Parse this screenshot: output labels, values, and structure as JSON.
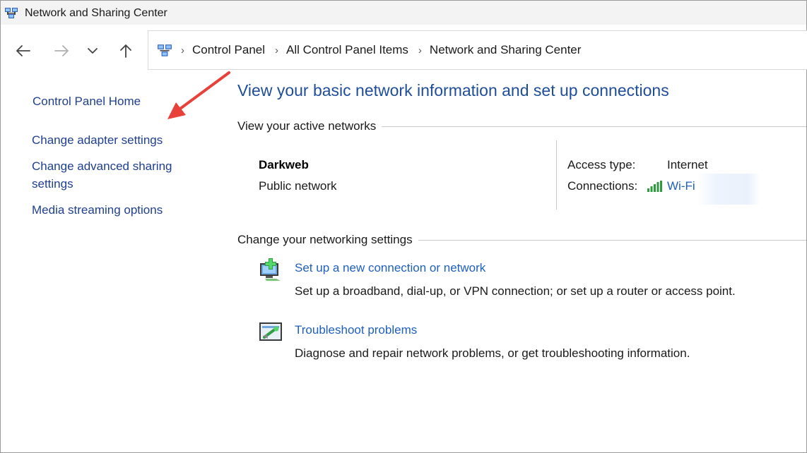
{
  "window": {
    "title": "Network and Sharing Center",
    "icon": "network-center-icon"
  },
  "navigation": {
    "back": "back-arrow-icon",
    "forward": "forward-arrow-icon",
    "recent": "chevron-down-icon",
    "up": "up-arrow-icon",
    "breadcrumb": [
      "Control Panel",
      "All Control Panel Items",
      "Network and Sharing Center"
    ]
  },
  "sidebar": {
    "items": [
      {
        "label": "Control Panel Home"
      },
      {
        "label": "Change adapter settings"
      },
      {
        "label": "Change advanced sharing",
        "label2": "settings"
      },
      {
        "label": "Media streaming options"
      }
    ]
  },
  "main": {
    "heading": "View your basic network information and set up connections",
    "active_networks": {
      "title": "View your active networks",
      "network_name": "Darkweb",
      "network_type": "Public network",
      "access_type_label": "Access type:",
      "access_type_value": "Internet",
      "connections_label": "Connections:",
      "connections_value": "Wi-Fi"
    },
    "networking_settings": {
      "title": "Change your networking settings",
      "tasks": [
        {
          "link": "Set up a new connection or network",
          "description": "Set up a broadband, dial-up, or VPN connection; or set up a router or access point.",
          "icon": "new-connection-icon"
        },
        {
          "link": "Troubleshoot problems",
          "description": "Diagnose and repair network problems, or get troubleshooting information.",
          "icon": "troubleshoot-icon"
        }
      ]
    }
  },
  "colors": {
    "link": "#1e5fbf",
    "sidebar_link": "#1f3f8f",
    "heading": "#1e4e9a",
    "annotation_arrow": "#e8413a",
    "signal": "#2e9b3c"
  }
}
